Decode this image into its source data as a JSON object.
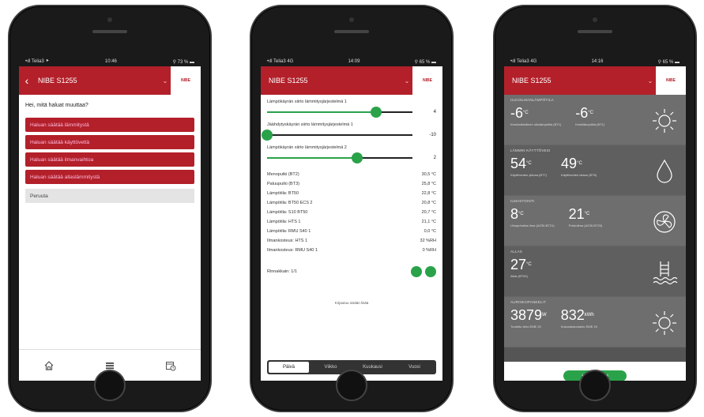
{
  "phone1": {
    "status": {
      "carrier": "•ıll Telia3 ⯈",
      "time": "10:46",
      "battery": "⚲ 73 % ▬"
    },
    "appbar": {
      "back": "‹",
      "title": "NIBE S1255",
      "chevron": "⌄",
      "logo": "NIBE"
    },
    "question": "Hei, mitä haluat muuttaa?",
    "options": [
      "Haluan säätää lämmitystä",
      "Haluan säätää käyttövettä",
      "Haluan säätää ilmanvaihtoa",
      "Haluan säätää allaslämmitystä"
    ],
    "cancel": "Peruuta"
  },
  "phone2": {
    "status": {
      "carrier": "•ıll Telia3 4G",
      "time": "14:09",
      "battery": "⚲ 65 % ▬"
    },
    "appbar": {
      "title": "NIBE S1255",
      "chevron": "⌄",
      "logo": "NIBE"
    },
    "sliders": [
      {
        "label": "Lämpökäyrän siirto lämmitysjärjestelmä 1",
        "value": "4",
        "level": 0.75
      },
      {
        "label": "Jäähdytyskäyrän siirto lämmitysjärjestelmä 1",
        "value": "-10",
        "level": 0.0
      },
      {
        "label": "Lämpökäyrän siirto lämmitysjärjestelmä 2",
        "value": "2",
        "level": 0.62
      }
    ],
    "readings": [
      {
        "label": "Menoputki (BT2)",
        "value": "30,5 °C"
      },
      {
        "label": "Paluuputki (BT3)",
        "value": "25,8 °C"
      },
      {
        "label": "Lämpötila: BT50",
        "value": "22,8 °C"
      },
      {
        "label": "Lämpötila: BT50 ECS 2",
        "value": "20,8 °C"
      },
      {
        "label": "Lämpötila: S10 BT50",
        "value": "20,7 °C"
      },
      {
        "label": "Lämpötila: HTS 1",
        "value": "21,1 °C"
      },
      {
        "label": "Lämpötila: RMU S40 1",
        "value": "0,0 °C"
      },
      {
        "label": "Ilmankosteus: HTS 1",
        "value": "32 %RH"
      },
      {
        "label": "Ilmankosteus: RMU S40 1",
        "value": "0 %RH"
      }
    ],
    "indicator_label": "Rinnakkain: 1/1",
    "note": "Kirjautuu sisään lisää",
    "segments": [
      "Päivä",
      "Viikko",
      "Kuukausi",
      "Vuosi"
    ]
  },
  "phone3": {
    "status": {
      "carrier": "•ıll Telia3 4G",
      "time": "14:16",
      "battery": "⚲ 65 % ▬"
    },
    "appbar": {
      "title": "NIBE S1255",
      "chevron": "⌄",
      "logo": "NIBE"
    },
    "tiles": [
      {
        "title": "ULKOILMANLÄMPÖTILA",
        "values": [
          {
            "big": "-6",
            "unit": "°C",
            "small": "Keskimääräinen ulkolämpötila (BT1)"
          },
          {
            "big": "-6",
            "unit": "°C",
            "small": "Keskilämpötila (BT1)"
          }
        ],
        "icon": "sun-icon"
      },
      {
        "title": "LÄMMIN KÄYTTÖVESI",
        "values": [
          {
            "big": "54",
            "unit": "°C",
            "small": "Käyttöveden yläosa (BT7)"
          },
          {
            "big": "49",
            "unit": "°C",
            "small": "Käyttöveden lataus (BT6)"
          }
        ],
        "icon": "drop-icon"
      },
      {
        "title": "ILMASTOINTI",
        "values": [
          {
            "big": "8",
            "unit": "°C",
            "small": "Ulospuhallus ilma (AZ30-BT21)"
          },
          {
            "big": "21",
            "unit": "°C",
            "small": "Poistoilma (AZ30-BT20)"
          }
        ],
        "icon": "fan-icon"
      },
      {
        "title": "ALLAS",
        "values": [
          {
            "big": "27",
            "unit": "°C",
            "small": "Allas (BT51)"
          }
        ],
        "icon": "pool-icon"
      },
      {
        "title": "AURINKOPANEELIT",
        "values": [
          {
            "big": "3879",
            "unit": "W",
            "small": "Tuotettu teho EME 20"
          },
          {
            "big": "832",
            "unit": "kWh",
            "small": "Kokonaistuotanto EME 20"
          }
        ],
        "icon": "sun-icon"
      }
    ],
    "footer_button": "+ Lisää muutos"
  }
}
